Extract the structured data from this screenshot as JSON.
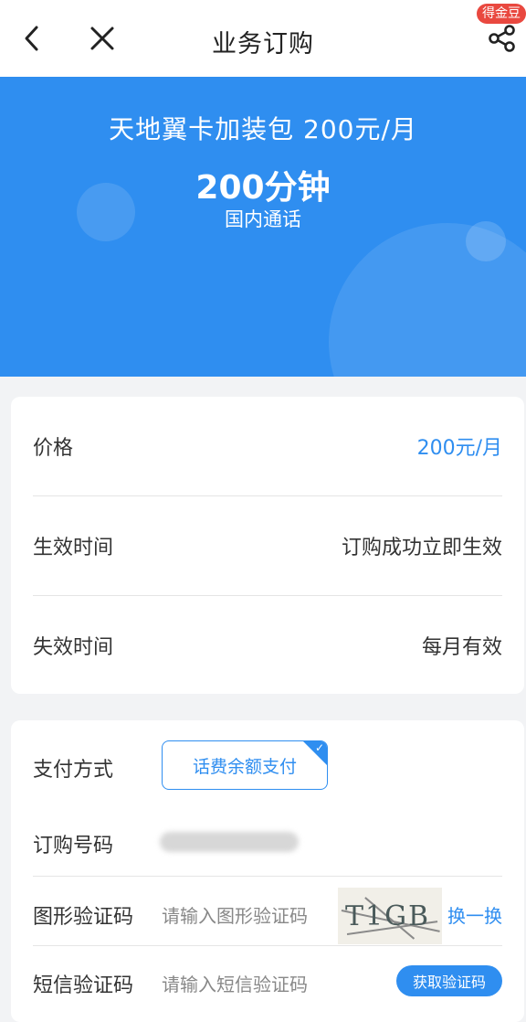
{
  "nav": {
    "title": "业务订购",
    "badge": "得金豆",
    "icons": [
      "back-icon",
      "close-icon",
      "share-icon"
    ]
  },
  "banner": {
    "title": "天地翼卡加装包  200元/月",
    "minutes": "200分钟",
    "subtitle": "国内通话"
  },
  "info": {
    "rows": [
      {
        "label": "价格",
        "value": "200元/月"
      },
      {
        "label": "生效时间",
        "value": "订购成功立即生效"
      },
      {
        "label": "失效时间",
        "value": "每月有效"
      }
    ]
  },
  "payment": {
    "method_label": "支付方式",
    "method_option": "话费余额支付",
    "number_label": "订购号码",
    "captcha_label": "图形验证码",
    "captcha_placeholder": "请输入图形验证码",
    "captcha_image_text": "T1GB",
    "captcha_swap": "换一换",
    "sms_label": "短信验证码",
    "sms_placeholder": "请输入短信验证码",
    "sms_button": "获取验证码"
  },
  "colors": {
    "accent": "#2f8ef0",
    "badge": "#e9483f"
  }
}
